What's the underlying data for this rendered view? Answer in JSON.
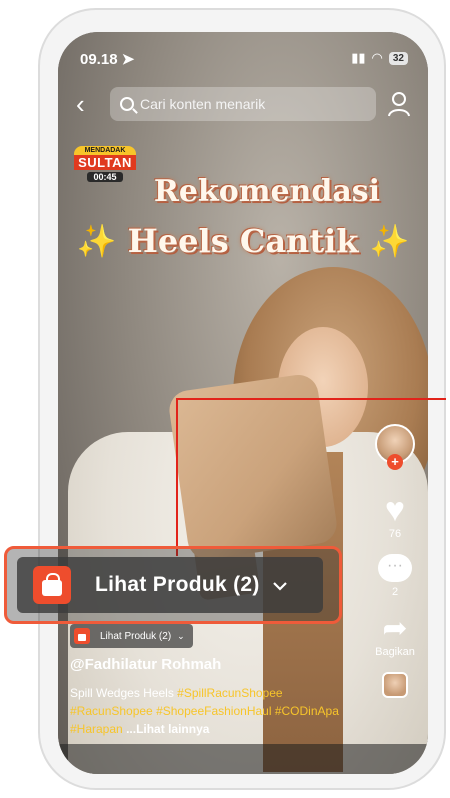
{
  "status_bar": {
    "time": "09.18",
    "battery": "32"
  },
  "search": {
    "placeholder": "Cari konten menarik"
  },
  "badge": {
    "top": "MENDADAK",
    "main": "SULTAN",
    "timer": "00:45"
  },
  "video_title": {
    "line1": "Rekomendasi",
    "line2": "Heels Cantik",
    "sparkles": "✨"
  },
  "actions": {
    "like_count": "76",
    "comment_count": "2",
    "share_label": "Bagikan"
  },
  "product_button": {
    "label": "Lihat Produk (2)",
    "chevron": "⌄"
  },
  "caption": {
    "username": "@Fadhilatur Rohmah",
    "text": "Spill Wedges Heels",
    "hashtags": [
      "#SpillRacunShopee",
      "#RacunShopee",
      "#ShopeeFashionHaul",
      "#CODinApa",
      "#Harapan"
    ],
    "see_more": "...Lihat lainnya"
  },
  "colors": {
    "accent": "#ee4d2d",
    "highlight": "#f7c52a",
    "callout_border": "#ef5b3a",
    "pointer": "#e2231a"
  },
  "icons": {
    "back": "chevron-left-icon",
    "search": "search-icon",
    "profile": "person-icon",
    "like": "heart-icon",
    "comment": "comment-icon",
    "share": "share-icon",
    "product": "shopping-bag-icon"
  }
}
